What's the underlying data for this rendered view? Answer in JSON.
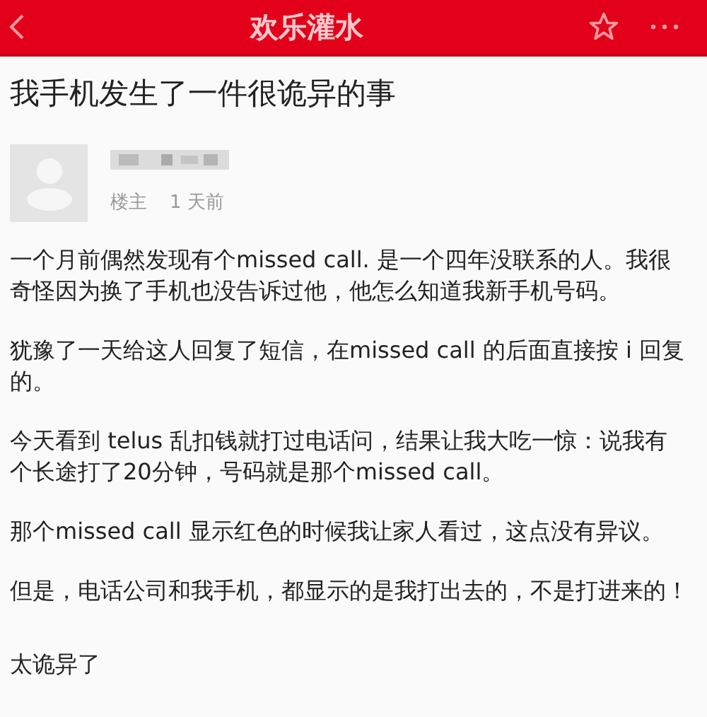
{
  "header": {
    "title": "欢乐灌水"
  },
  "post": {
    "title": "我手机发生了一件很诡异的事",
    "author": {
      "role": "楼主",
      "time": "1 天前"
    },
    "paragraphs": [
      "一个月前偶然发现有个missed call. 是一个四年没联系的人。我很奇怪因为换了手机也没告诉过他，他怎么知道我新手机号码。",
      "犹豫了一天给这人回复了短信，在missed call 的后面直接按 i 回复的。",
      "今天看到 telus 乱扣钱就打过电话问，结果让我大吃一惊：说我有个长途打了20分钟，号码就是那个missed call。",
      "那个missed call 显示红色的时候我让家人看过，这点没有异议。",
      "但是，电话公司和我手机，都显示的是我打出去的，不是打进来的！",
      "太诡异了"
    ]
  }
}
